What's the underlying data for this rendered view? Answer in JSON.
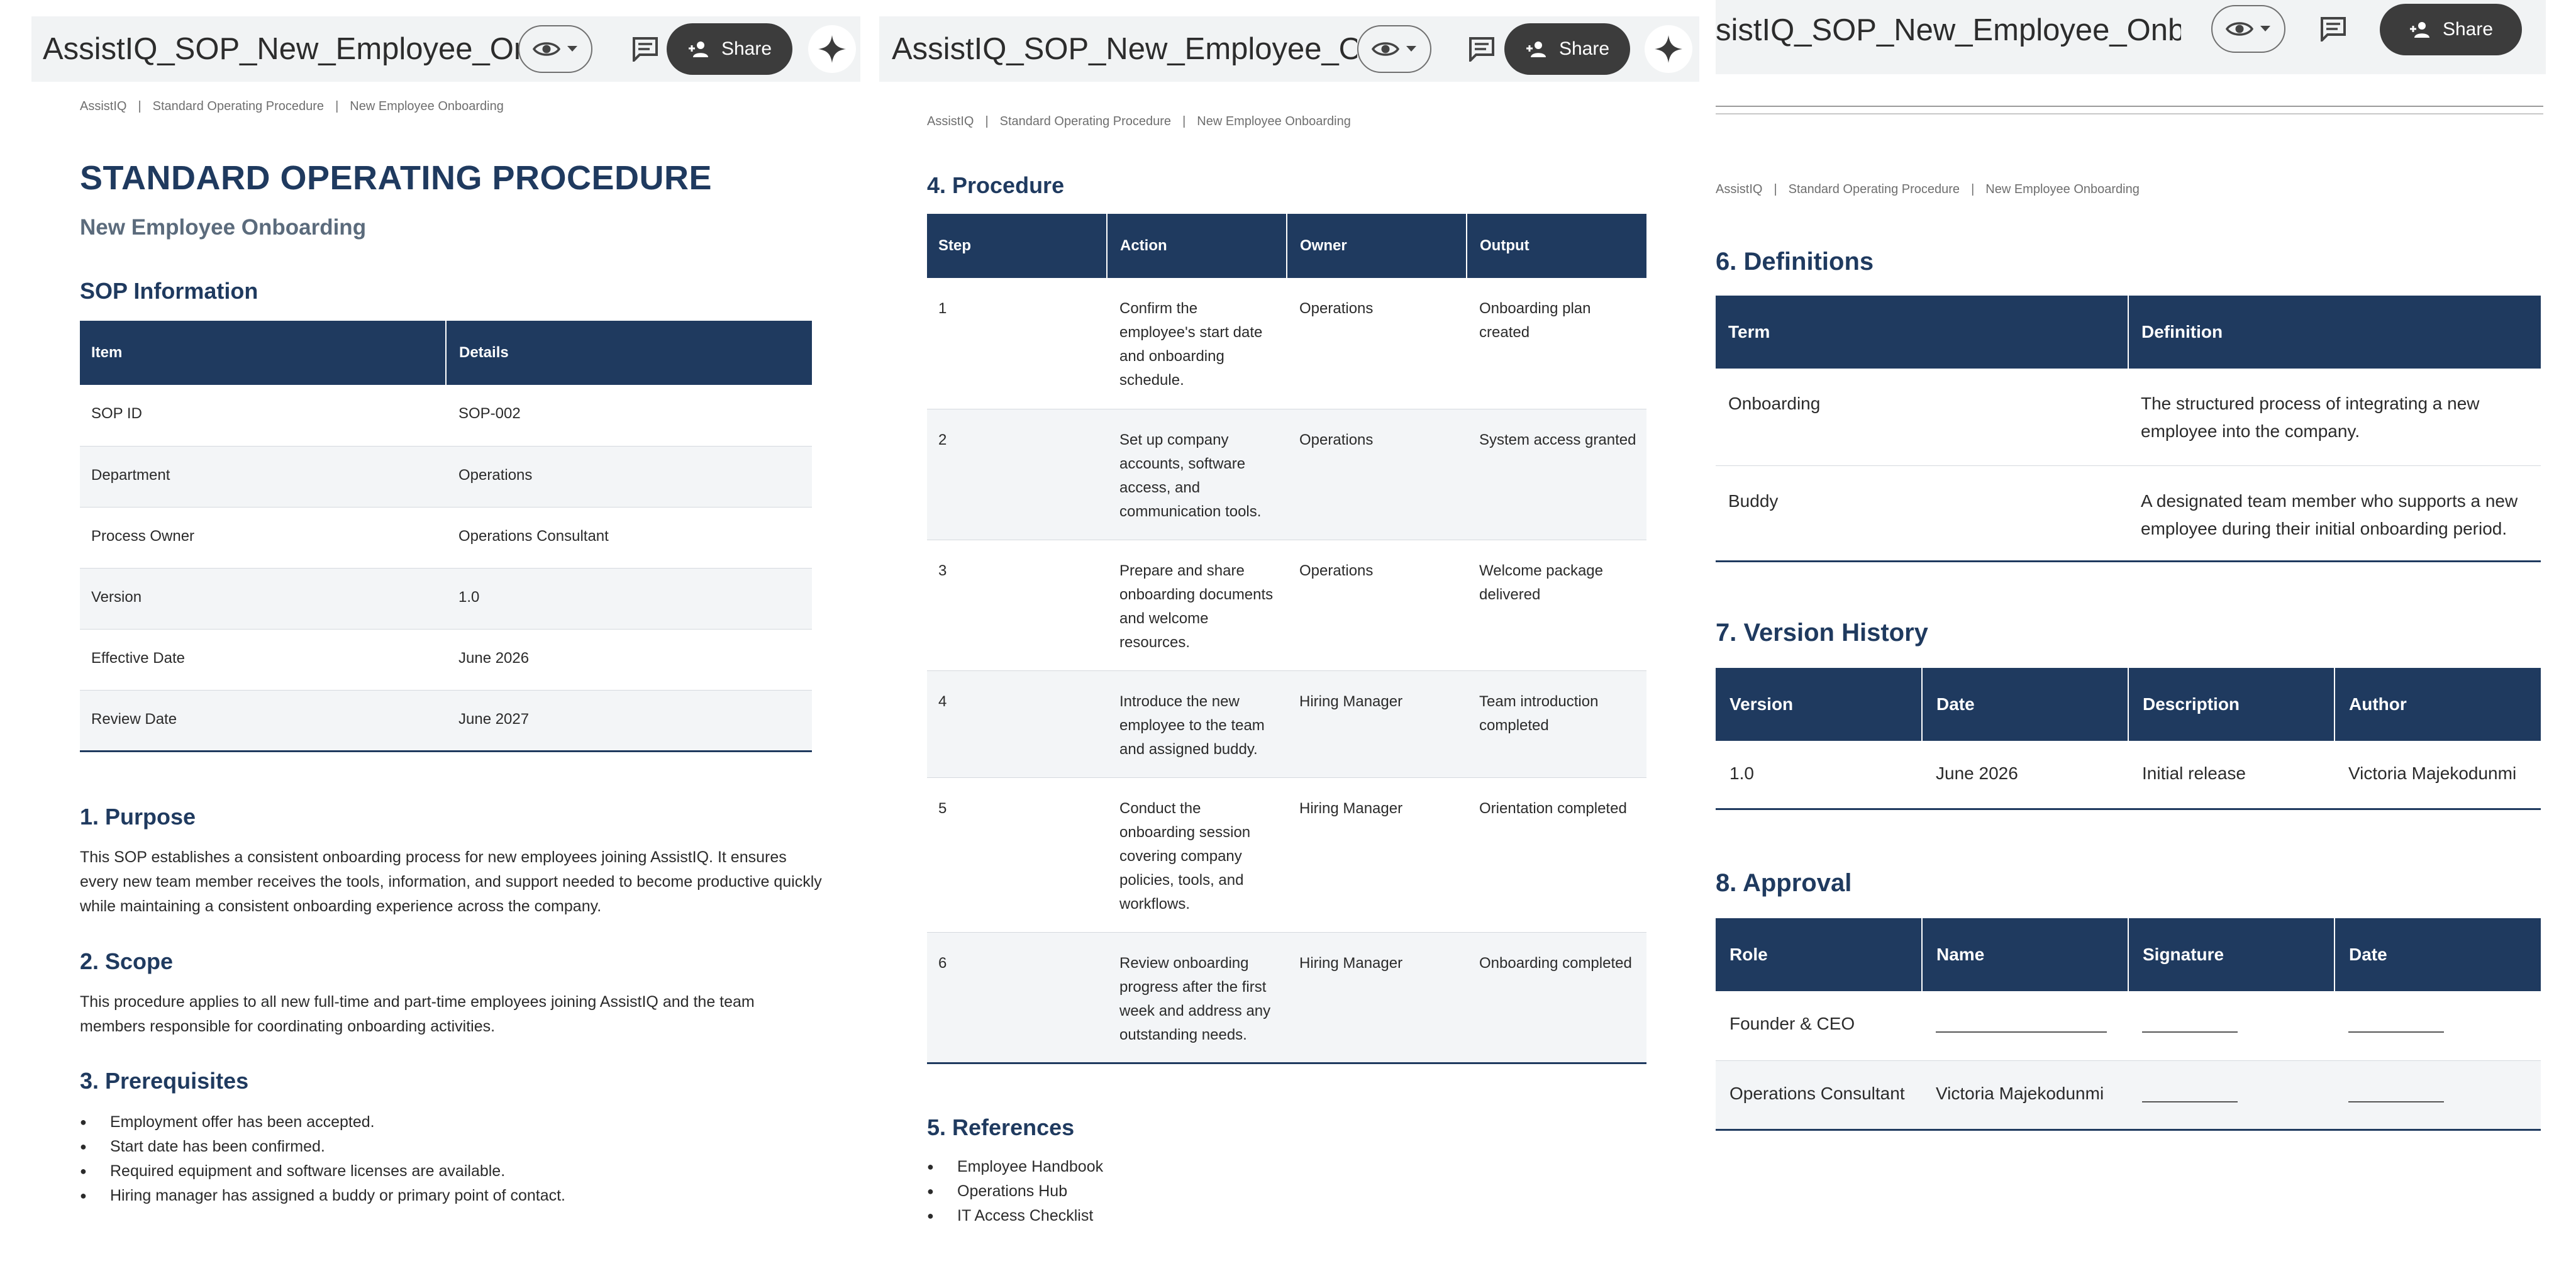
{
  "doc_title": "AssistIQ_SOP_New_Employee_Onb...",
  "doc_title_p3": "sistIQ_SOP_New_Employee_Onb...",
  "share_label": "Share",
  "breadcrumb": [
    "AssistIQ",
    "|",
    "Standard Operating Procedure",
    "|",
    "New Employee Onboarding"
  ],
  "page1": {
    "title": "STANDARD OPERATING PROCEDURE",
    "subtitle": "New Employee Onboarding",
    "sop_info_heading": "SOP Information",
    "sop_info_table": {
      "headers": [
        "Item",
        "Details"
      ],
      "rows": [
        [
          "SOP ID",
          "SOP-002"
        ],
        [
          "Department",
          "Operations"
        ],
        [
          "Process Owner",
          "Operations Consultant"
        ],
        [
          "Version",
          "1.0"
        ],
        [
          "Effective Date",
          "June 2026"
        ],
        [
          "Review Date",
          "June 2027"
        ]
      ]
    },
    "purpose_heading": "1. Purpose",
    "purpose_text": "This SOP establishes a consistent onboarding process for new employees joining AssistIQ. It ensures every new team member receives the tools, information, and support needed to become productive quickly while maintaining a consistent onboarding experience across the company.",
    "scope_heading": "2. Scope",
    "scope_text": "This procedure applies to all new full-time and part-time employees joining AssistIQ and the team members responsible for coordinating onboarding activities.",
    "prereq_heading": "3. Prerequisites",
    "prereq_items": [
      "Employment offer has been accepted.",
      "Start date has been confirmed.",
      "Required equipment and software licenses are available.",
      "Hiring manager has assigned a buddy or primary point of contact."
    ]
  },
  "page2": {
    "procedure_heading": "4. Procedure",
    "procedure_table": {
      "headers": [
        "Step",
        "Action",
        "Owner",
        "Output"
      ],
      "rows": [
        [
          "1",
          "Confirm the employee's start date and onboarding schedule.",
          "Operations",
          "Onboarding plan created"
        ],
        [
          "2",
          "Set up company accounts, software access, and communication tools.",
          "Operations",
          "System access granted"
        ],
        [
          "3",
          "Prepare and share onboarding documents and welcome resources.",
          "Operations",
          "Welcome package delivered"
        ],
        [
          "4",
          "Introduce the new employee to the team and assigned buddy.",
          "Hiring Manager",
          "Team introduction completed"
        ],
        [
          "5",
          "Conduct the onboarding session covering company policies, tools, and workflows.",
          "Hiring Manager",
          "Orientation completed"
        ],
        [
          "6",
          "Review onboarding progress after the first week and address any outstanding needs.",
          "Hiring Manager",
          "Onboarding completed"
        ]
      ]
    },
    "references_heading": "5. References",
    "references_items": [
      "Employee Handbook",
      "Operations Hub",
      "IT Access Checklist"
    ]
  },
  "page3": {
    "definitions_heading": "6. Definitions",
    "definitions_table": {
      "headers": [
        "Term",
        "Definition"
      ],
      "rows": [
        [
          "Onboarding",
          "The structured process of integrating a new employee into the company."
        ],
        [
          "Buddy",
          "A designated team member who supports a new employee during their initial onboarding period."
        ]
      ]
    },
    "version_heading": "7. Version History",
    "version_table": {
      "headers": [
        "Version",
        "Date",
        "Description",
        "Author"
      ],
      "rows": [
        [
          "1.0",
          "June 2026",
          "Initial release",
          "Victoria Majekodunmi"
        ]
      ]
    },
    "approval_heading": "8. Approval",
    "approval_table": {
      "headers": [
        "Role",
        "Name",
        "Signature",
        "Date"
      ],
      "rows": [
        [
          "Founder & CEO",
          "",
          "",
          ""
        ],
        [
          "Operations Consultant",
          "Victoria Majekodunmi",
          "",
          ""
        ]
      ]
    }
  },
  "colors": {
    "header_navy": "#1f3a5f",
    "toolbar_bg": "#f1f3f4",
    "share_bg": "#3c3c3c"
  }
}
